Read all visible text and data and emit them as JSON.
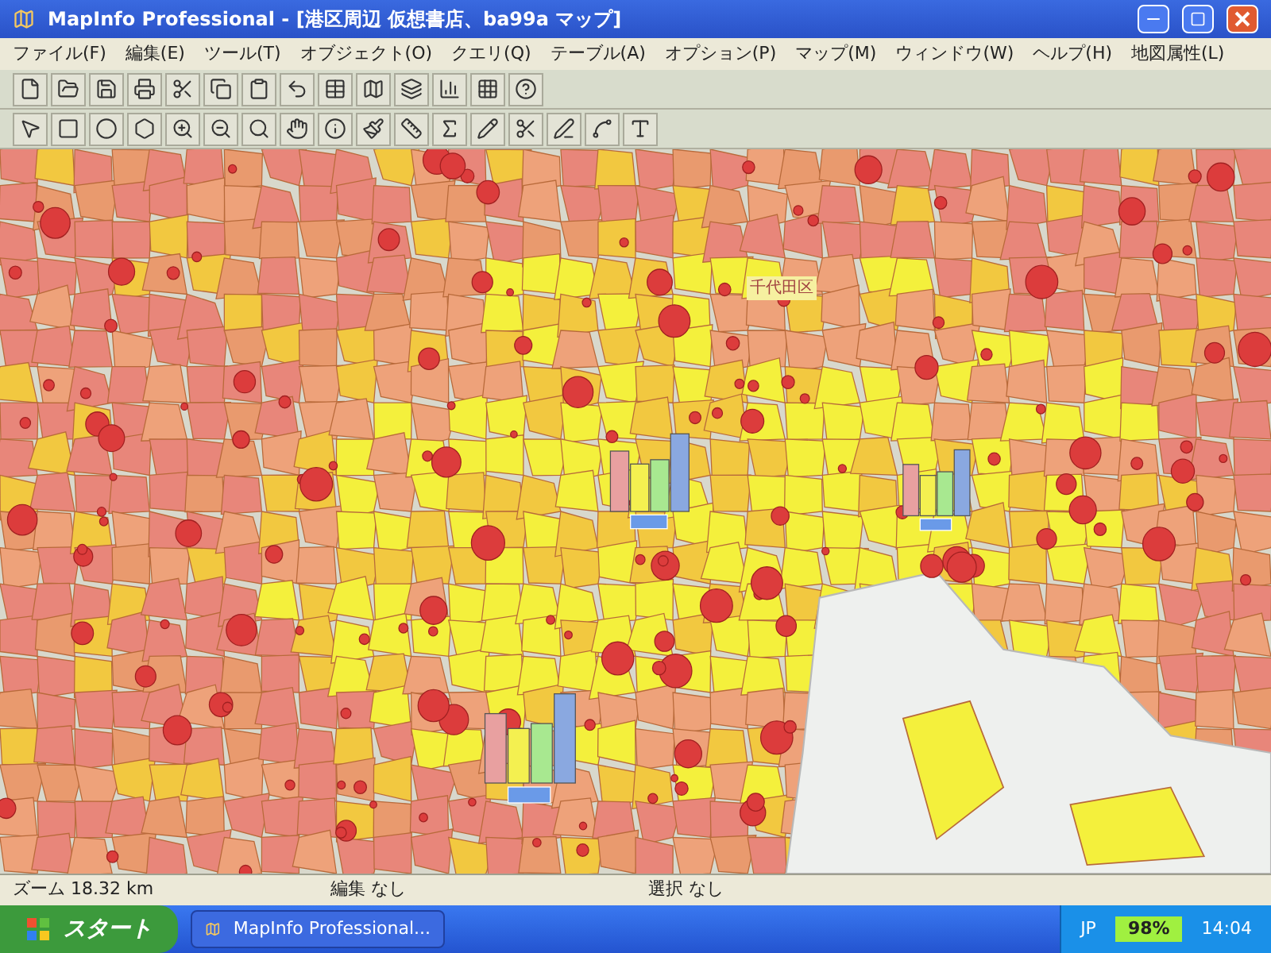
{
  "window": {
    "title": "MapInfo Professional - [港区周辺 仮想書店、ba99a マップ]"
  },
  "menu": [
    "ファイル(F)",
    "編集(E)",
    "ツール(T)",
    "オブジェクト(O)",
    "クエリ(Q)",
    "テーブル(A)",
    "オプション(P)",
    "マップ(M)",
    "ウィンドウ(W)",
    "ヘルプ(H)",
    "地図属性(L)"
  ],
  "map": {
    "labels": [
      "千代田区"
    ]
  },
  "status_bar": {
    "zoom": "ズーム 18.32 km",
    "edit": "編集 なし",
    "selection": "選択 なし"
  },
  "taskbar": {
    "start": "スタート",
    "task": "MapInfo Professional...",
    "language": "JP",
    "battery": "98%",
    "clock": "14:04"
  }
}
